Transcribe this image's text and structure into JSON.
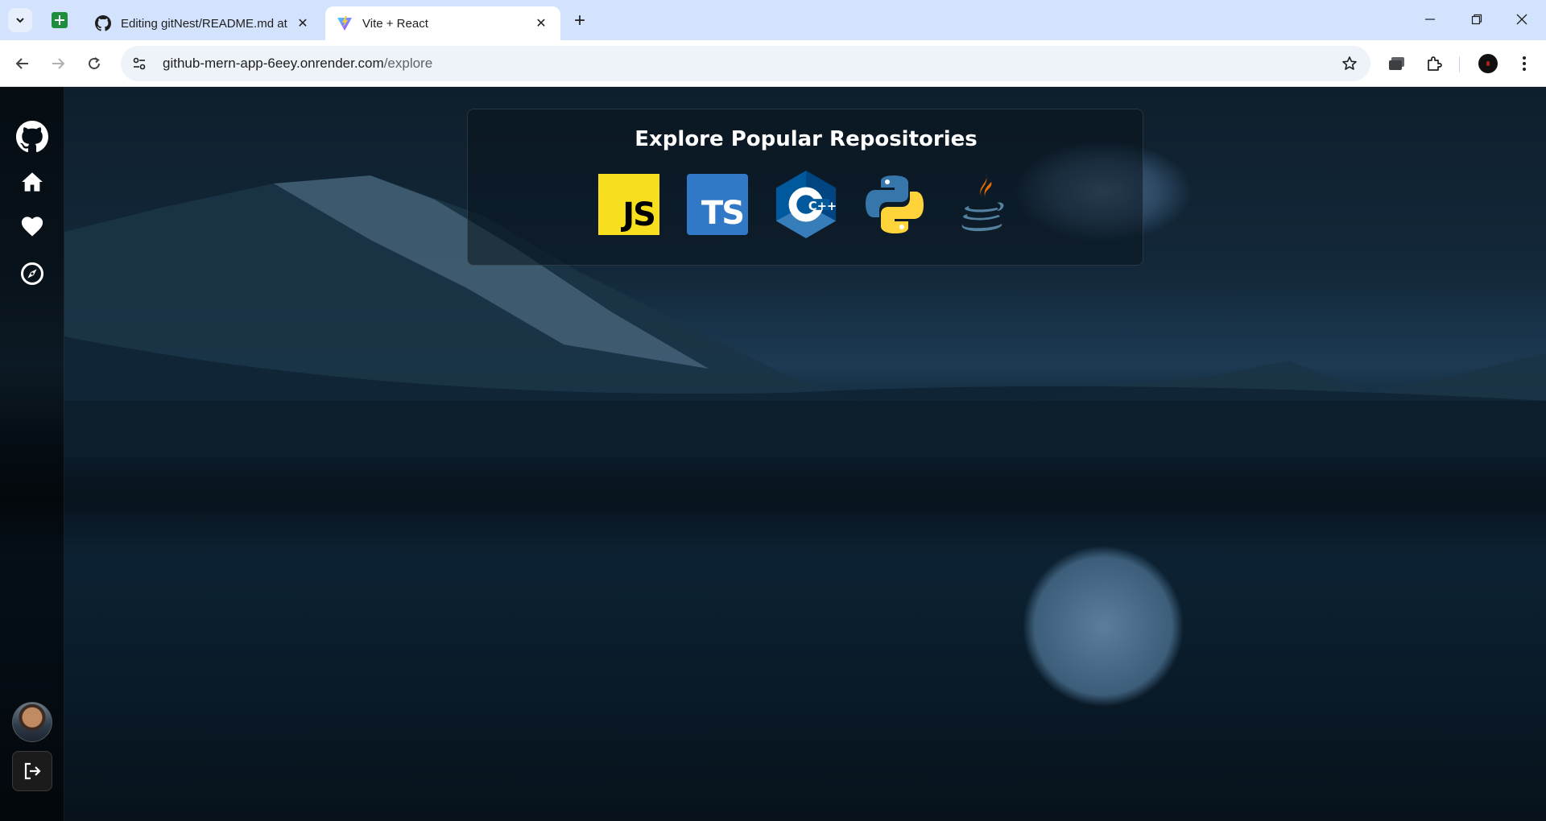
{
  "browser": {
    "tabs": [
      {
        "title": "Editing gitNest/README.md at",
        "icon": "github-icon",
        "active": false
      },
      {
        "title": "Vite + React",
        "icon": "vite-icon",
        "active": true
      }
    ],
    "pinned_tab_icon": "google-sheets-icon",
    "url_host": "github-mern-app-6eey.onrender.com",
    "url_path": "/explore"
  },
  "sidebar": {
    "items": [
      {
        "name": "github-logo-icon"
      },
      {
        "name": "home-icon"
      },
      {
        "name": "heart-icon"
      },
      {
        "name": "explore-compass-icon"
      }
    ],
    "avatar": "avatar",
    "logout": "logout-icon"
  },
  "explore": {
    "title": "Explore Popular Repositories",
    "languages": [
      {
        "name": "javascript",
        "logo_text": "JS",
        "color": "#f7df1e"
      },
      {
        "name": "typescript",
        "logo_text": "TS",
        "color": "#3178c6"
      },
      {
        "name": "c++",
        "logo_text": "C++",
        "color": "#00599c"
      },
      {
        "name": "python",
        "logo_text": "",
        "color": "#3776ab"
      },
      {
        "name": "java",
        "logo_text": "",
        "color": "#e76f00"
      }
    ]
  },
  "colors": {
    "tabbar_bg": "#d3e3fd",
    "omnibox_bg": "#eef2f9",
    "page_bg": "#0b1a26"
  }
}
